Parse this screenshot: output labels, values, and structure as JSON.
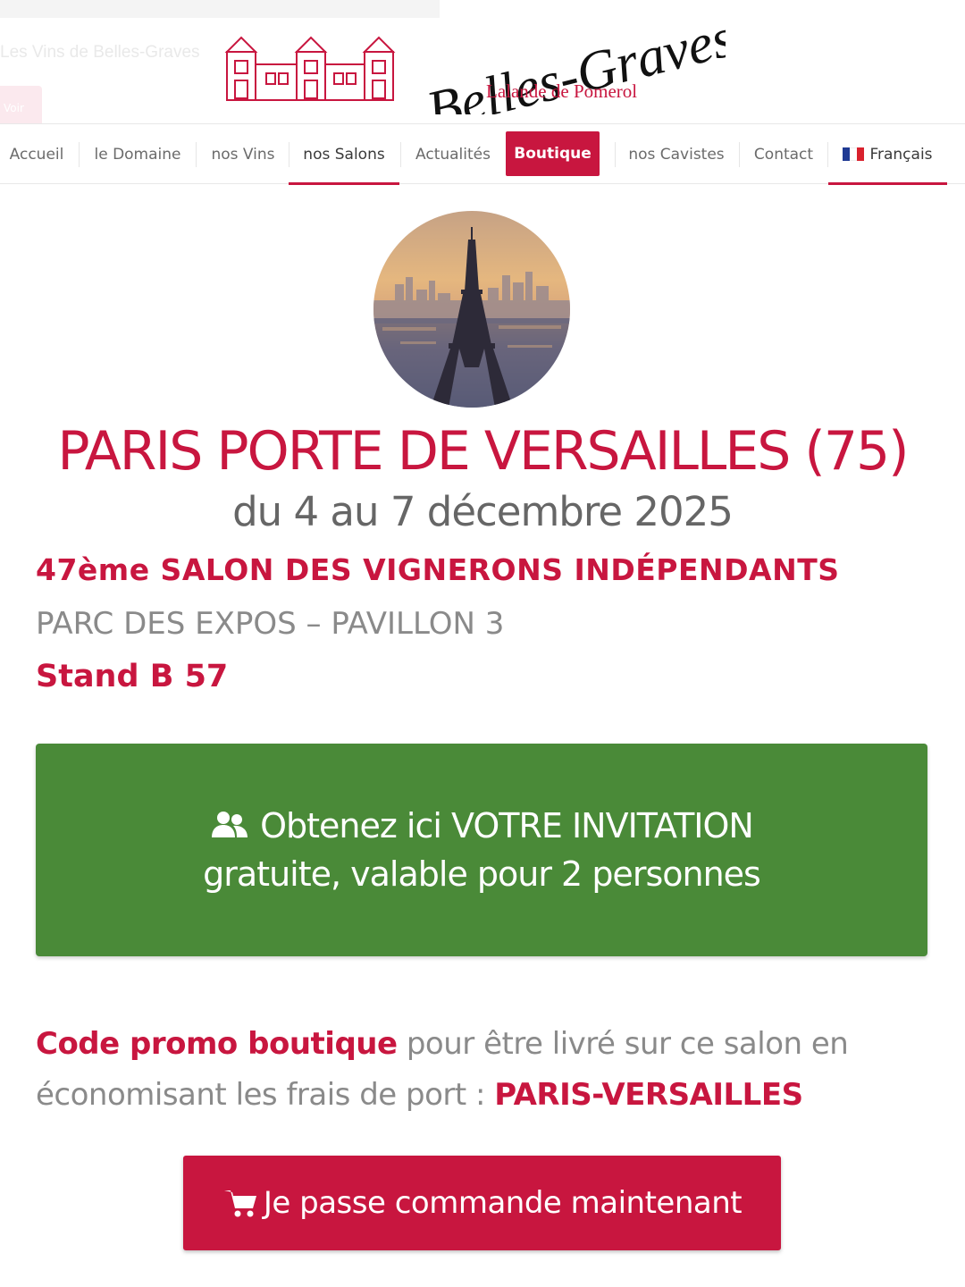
{
  "header": {
    "ghost_text": "Les Vins de Belles-Graves",
    "brand_name": "Belles-Graves",
    "brand_subtitle": "Lalande de Pomerol",
    "ghost_button_label": "Voir"
  },
  "nav": {
    "items": [
      {
        "label": "Accueil",
        "active": false
      },
      {
        "label": "le Domaine",
        "active": false
      },
      {
        "label": "nos Vins",
        "active": false
      },
      {
        "label": "nos Salons",
        "active": true
      },
      {
        "label": "Actualités",
        "active": false
      },
      {
        "label": "Boutique",
        "highlight": true
      },
      {
        "label": "nos Cavistes",
        "active": false
      },
      {
        "label": "Contact",
        "active": false
      },
      {
        "label": "Français",
        "active": true,
        "icon": "french-flag-icon"
      }
    ]
  },
  "event": {
    "image_icon": "eiffel-tower-photo",
    "title": "PARIS PORTE DE VERSAILLES (75)",
    "dates": "du 4 au 7 décembre 2025",
    "salon_name": "47ème SALON DES VIGNERONS INDÉPENDANTS",
    "venue": "PARC DES EXPOS – PAVILLON 3",
    "stand": "Stand B 57"
  },
  "invitation": {
    "icon": "users-icon",
    "line1": "Obtenez ici VOTRE INVITATION",
    "line2": "gratuite, valable pour 2 personnes"
  },
  "promo": {
    "label": "Code promo boutique",
    "text1": " pour être livré sur ce salon en économisant les frais de port : ",
    "code": "PARIS-VERSAILLES"
  },
  "order": {
    "icon": "cart-icon",
    "label": "Je passe commande maintenant"
  },
  "colors": {
    "accent": "#c8163f",
    "green": "#4a8a38",
    "text_gray": "#8a8a8a",
    "flag_blue": "#1f3a93",
    "flag_red": "#d9212d"
  }
}
